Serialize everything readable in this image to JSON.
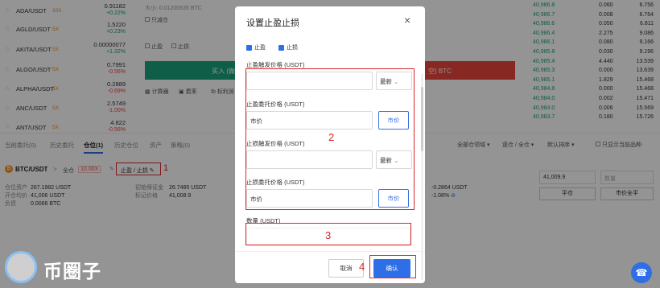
{
  "markets": [
    {
      "symbol": "ADA/USDT",
      "lev": "10X",
      "price": "0.91182",
      "change": "+0.22%",
      "dir": "up"
    },
    {
      "symbol": "AGLD/USDT",
      "lev": "5X",
      "price": "1.5220",
      "change": "+0.23%",
      "dir": "up"
    },
    {
      "symbol": "AKITA/USDT",
      "lev": "5X",
      "price": "0.00000077",
      "change": "+1.32%",
      "dir": "up"
    },
    {
      "symbol": "ALGO/USDT",
      "lev": "5X",
      "price": "0.7991",
      "change": "-0.56%",
      "dir": "down"
    },
    {
      "symbol": "ALPHA/USDT",
      "lev": "5X",
      "price": "0.2889",
      "change": "-0.69%",
      "dir": "down"
    },
    {
      "symbol": "ANC/USDT",
      "lev": "5X",
      "price": "2.5749",
      "change": "-1.00%",
      "dir": "down"
    },
    {
      "symbol": "ANT/USDT",
      "lev": "5X",
      "price": "4.822",
      "change": "-0.56%",
      "dir": "down"
    }
  ],
  "order_panel": {
    "min_size": "大小: 0.01200635 BTC",
    "reduce_only": "只减仓",
    "tp": "止盈",
    "sl": "止损",
    "buy_label": "买入 (做",
    "sell_label": "空) BTC",
    "calc": "计算器",
    "fee": "费率",
    "tag": "Ib 标利润"
  },
  "orderbook": [
    {
      "price": "40,986.8",
      "qty": "0.060",
      "total": "6.756"
    },
    {
      "price": "40,986.7",
      "qty": "0.008",
      "total": "6.764"
    },
    {
      "price": "40,986.6",
      "qty": "0.050",
      "total": "6.811"
    },
    {
      "price": "40,986.4",
      "qty": "2.275",
      "total": "9.086"
    },
    {
      "price": "40,986.1",
      "qty": "0.080",
      "total": "9.166"
    },
    {
      "price": "40,985.8",
      "qty": "0.030",
      "total": "9.196"
    },
    {
      "price": "40,985.4",
      "qty": "4.440",
      "total": "13.539"
    },
    {
      "price": "40,985.3",
      "qty": "0.000",
      "total": "13.639"
    },
    {
      "price": "40,985.1",
      "qty": "1.829",
      "total": "15.468"
    },
    {
      "price": "40,984.8",
      "qty": "0.000",
      "total": "15.468"
    },
    {
      "price": "40,984.0",
      "qty": "0.002",
      "total": "15.471"
    },
    {
      "price": "40,984.0",
      "qty": "0.006",
      "total": "15.569"
    },
    {
      "price": "40,983.7",
      "qty": "0.180",
      "total": "15.726"
    }
  ],
  "tabs": [
    "当前委托(0)",
    "历史委托",
    "仓位(1)",
    "历史仓位",
    "资产",
    "策略(0)"
  ],
  "filters": {
    "f1": "全部仓领域",
    "f2": "逐仓 / 全仓",
    "f3": "默认排序",
    "f4": "只显示当前品种"
  },
  "position": {
    "symbol": "BTC/USDT",
    "arrow": ">",
    "mode": "全仓",
    "lev": "10.00X",
    "tpsl": "止盈 / 止损",
    "margin_label": "仓位资产",
    "margin": "267.1982 USDT",
    "open_label": "开仓均价",
    "open": "41,006 USDT",
    "size_label": "负债",
    "size": "0.0066 BTC",
    "init_label": "初始保证金",
    "init": "26.7485 USDT",
    "mark_label": "标记价格",
    "mark": "41,008.9",
    "pnl": "-0.2864 USDT",
    "pnl_pct": "-1.08%",
    "price_input": "41,009.9",
    "qty_placeholder": "数量",
    "close_btn": "平仓",
    "market_close_btn": "市价全平"
  },
  "modal": {
    "title": "设置止盈止损",
    "chk_tp": "止盈",
    "chk_sl": "止损",
    "tp_trigger_label": "止盈触发价格 (USDT)",
    "tp_trigger_sel": "最新",
    "tp_order_label": "止盈委托价格 (USDT)",
    "tp_order_value": "市价",
    "tp_market_btn": "市价",
    "sl_trigger_label": "止损触发价格 (USDT)",
    "sl_trigger_sel": "最新",
    "sl_order_label": "止损委托价格 (USDT)",
    "sl_order_value": "市价",
    "sl_market_btn": "市价",
    "qty_label": "数量 (USDT)",
    "cancel": "取消",
    "confirm": "确认"
  },
  "annotations": {
    "n1": "1",
    "n2": "2",
    "n3": "3",
    "n4": "4"
  },
  "watermark": "币圈子",
  "colors": {
    "up": "#1aa37a",
    "down": "#e8453c",
    "accent": "#2e6ee6",
    "annot": "#d9262b"
  }
}
